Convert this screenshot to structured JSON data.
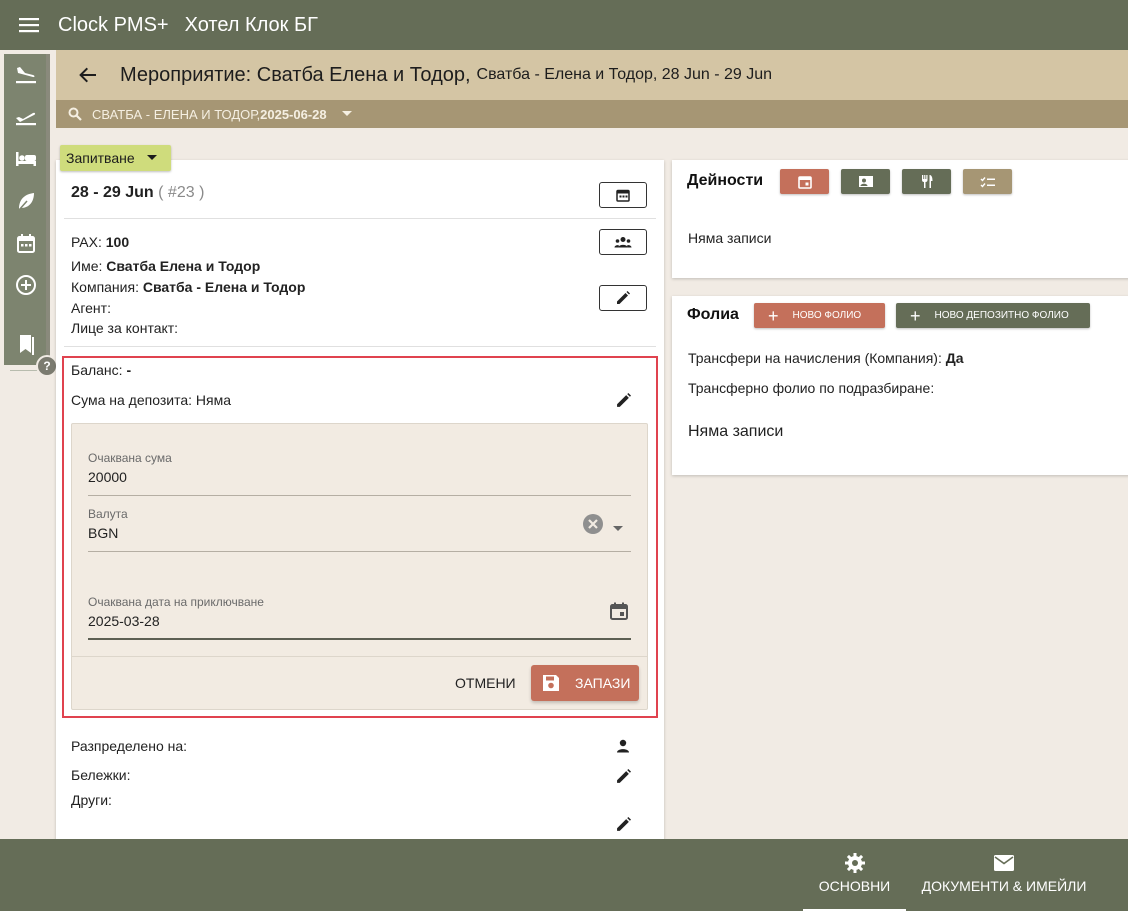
{
  "topbar": {
    "app_name": "Clock PMS+",
    "hotel_name": "Хотел Клок БГ"
  },
  "sidebar": {
    "icons": [
      "flight-land-icon",
      "flight-takeoff-icon",
      "bed-icon",
      "leaf-icon",
      "calendar-icon",
      "add-circle-icon",
      "bookmarks-icon"
    ],
    "help": "?"
  },
  "header": {
    "title": "Мероприятие: Сватба Елена и Тодор,",
    "subtitle": "Сватба - Елена и Тодор, 28 Jun - 29 Jun"
  },
  "search": {
    "text": "СВАТБА - ЕЛЕНА И ТОДОР, ",
    "date": "2025-06-28"
  },
  "status": {
    "label": "Запитване"
  },
  "event": {
    "dates": "28 - 29 Jun",
    "number": "( #23 )",
    "pax_label": "PAX:",
    "pax_value": "100",
    "name_label": "Име:",
    "name_value": "Сватба Елена и Тодор",
    "company_label": "Компания:",
    "company_value": "Сватба - Елена и Тодор",
    "agent_label": "Агент:",
    "contact_label": "Лице за контакт:"
  },
  "deposit": {
    "balance_label": "Баланс:",
    "balance_value": "-",
    "deposit_label": "Сума на депозита: Няма",
    "expected_amount_label": "Очаквана сума",
    "expected_amount_value": "20000",
    "currency_label": "Валута",
    "currency_value": "BGN",
    "due_date_label": "Очаквана дата на приключване",
    "due_date_value": "2025-03-28",
    "cancel_label": "ОТМЕНИ",
    "save_label": "ЗАПАЗИ"
  },
  "lower": {
    "assigned_label": "Разпределено на:",
    "notes_label": "Бележки:",
    "other_label": "Други:"
  },
  "activities": {
    "title": "Дейности",
    "empty": "Няма записи",
    "buttons": [
      {
        "icon": "event-icon",
        "color": "#c4705b"
      },
      {
        "icon": "presentation-icon",
        "color": "#656d57"
      },
      {
        "icon": "restaurant-icon",
        "color": "#656d57"
      },
      {
        "icon": "checklist-icon",
        "color": "#a69674"
      }
    ]
  },
  "folios": {
    "title": "Фолиа",
    "new_folio": "НОВО ФОЛИО",
    "new_deposit_folio": "НОВО ДЕПОЗИТНО ФОЛИО",
    "transfer_label": "Трансфери на начисления (Компания):",
    "transfer_value": "Да",
    "default_folio_label": "Трансферно фолио по подразбиране:",
    "empty": "Няма записи"
  },
  "bottom_tabs": [
    {
      "label": "ОСНОВНИ",
      "icon": "gear-icon",
      "active": true
    },
    {
      "label": "ДОКУМЕНТИ & ИМЕЙЛИ",
      "icon": "mail-icon",
      "active": false
    }
  ],
  "colors": {
    "primary": "#656d57",
    "accent": "#c4705b",
    "header": "#d4c5a4",
    "search": "#a69674",
    "status": "#cfdc7c",
    "highlight": "#e0434f"
  }
}
